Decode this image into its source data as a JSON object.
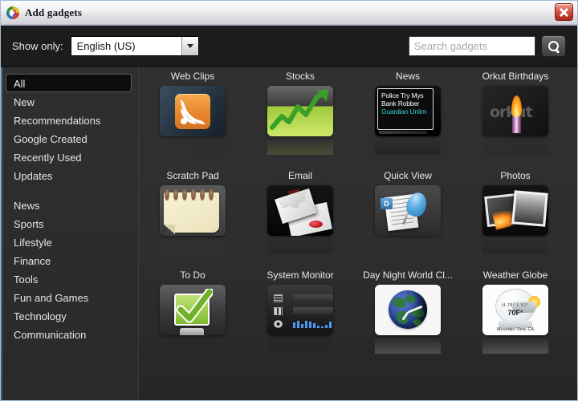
{
  "window": {
    "title": "Add gadgets",
    "app_icon": "google-desktop-swirl-icon",
    "close_label": "×"
  },
  "toolbar": {
    "show_only_label": "Show only:",
    "language_value": "English (US)",
    "language_caret": "chevron-down-icon",
    "search_placeholder": "Search gadgets",
    "search_value": "",
    "search_button_icon": "search-icon"
  },
  "sidebar": {
    "group1": [
      {
        "label": "All",
        "selected": true
      },
      {
        "label": "New",
        "selected": false
      },
      {
        "label": "Recommendations",
        "selected": false
      },
      {
        "label": "Google Created",
        "selected": false
      },
      {
        "label": "Recently Used",
        "selected": false
      },
      {
        "label": "Updates",
        "selected": false
      }
    ],
    "group2": [
      {
        "label": "News"
      },
      {
        "label": "Sports"
      },
      {
        "label": "Lifestyle"
      },
      {
        "label": "Finance"
      },
      {
        "label": "Tools"
      },
      {
        "label": "Fun and Games"
      },
      {
        "label": "Technology"
      },
      {
        "label": "Communication"
      }
    ]
  },
  "gadgets": {
    "rows": [
      [
        {
          "name": "Web Clips",
          "art": "webclips"
        },
        {
          "name": "Stocks",
          "art": "stocks"
        },
        {
          "name": "News",
          "art": "news"
        },
        {
          "name": "Orkut Birthdays",
          "art": "orkut"
        }
      ],
      [
        {
          "name": "Scratch Pad",
          "art": "scratch"
        },
        {
          "name": "Email",
          "art": "email"
        },
        {
          "name": "Quick View",
          "art": "quick"
        },
        {
          "name": "Photos",
          "art": "photos"
        }
      ],
      [
        {
          "name": "To Do",
          "art": "todo"
        },
        {
          "name": "System Monitor",
          "art": "sysmon"
        },
        {
          "name": "Day Night World Cl...",
          "art": "clock"
        },
        {
          "name": "Weather Globe",
          "art": "weather"
        }
      ]
    ]
  },
  "thumbnails": {
    "news_headlines": {
      "line1": "Police Try Mys",
      "line2": "Bank Robber",
      "source": "Guardian Unlim"
    },
    "orkut_wordmark": "orkut",
    "quickview_badge": "D",
    "weather": {
      "hilo": "H 78°    L 51°",
      "temp": "70F°",
      "city": "Mountain View, CA"
    }
  },
  "colors": {
    "window_border": "#9dbcd8",
    "titlebar_top": "#fbfbfc",
    "body_bg": "#2e2e2e",
    "toolbar_bg": "#1c1c1c",
    "text": "#e6e6e6",
    "close_red": "#c0342a",
    "accent_blue": "#2f6fa8"
  }
}
